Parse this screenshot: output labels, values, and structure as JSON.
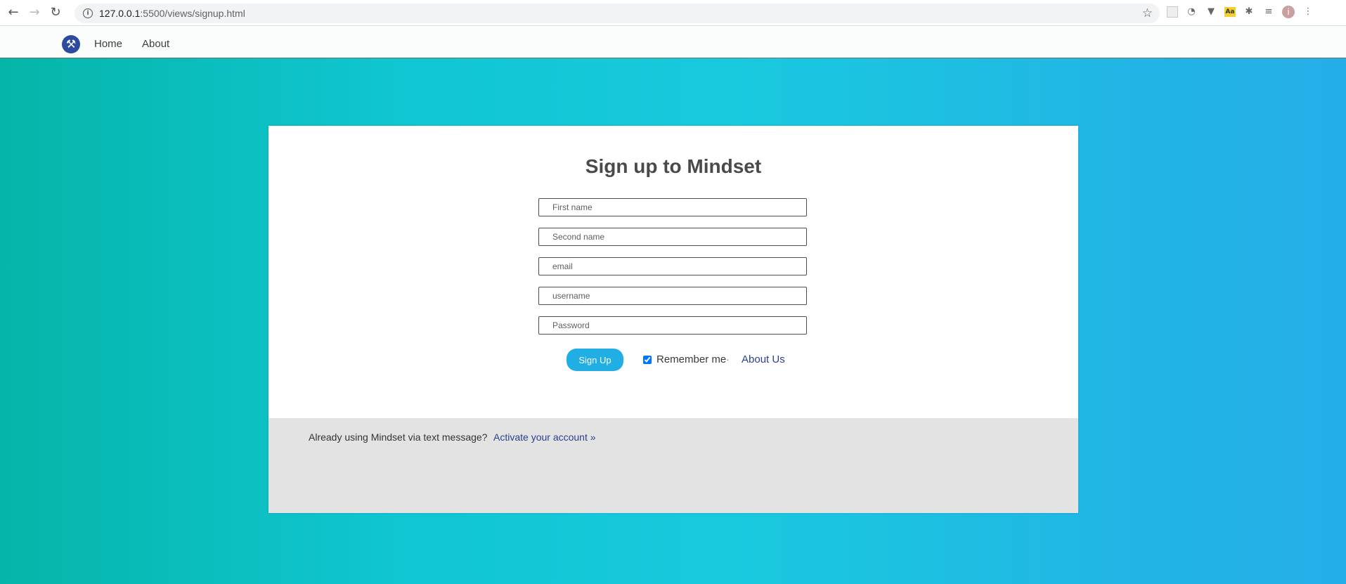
{
  "browser": {
    "url_host": "127.0.0.1",
    "url_rest": ":5500/views/signup.html",
    "back_icon": "←",
    "forward_icon": "→",
    "reload_icon": "↻",
    "info_icon": "i",
    "star_icon": "☆",
    "extensions": [
      "□",
      "◔",
      "▼",
      "Aa",
      "✱",
      "≡",
      "i",
      "⋮"
    ]
  },
  "nav": {
    "logo_glyph": "⚒",
    "links": [
      "Home",
      "About"
    ]
  },
  "form": {
    "title": "Sign up to Mindset",
    "placeholders": {
      "first_name": "First name",
      "second_name": "Second name",
      "email": "email",
      "username": "username",
      "password": "Password"
    },
    "submit_label": "Sign Up",
    "remember_label": "Remember me",
    "remember_checked": true,
    "separator": "·",
    "about_link": "About Us"
  },
  "footer": {
    "text": "Already using Mindset via text message?",
    "link": "Activate your account »"
  },
  "colors": {
    "accent": "#21aee5",
    "link": "#2a3f8f",
    "gradient_start": "#05b5a8",
    "gradient_end": "#24aee8"
  }
}
